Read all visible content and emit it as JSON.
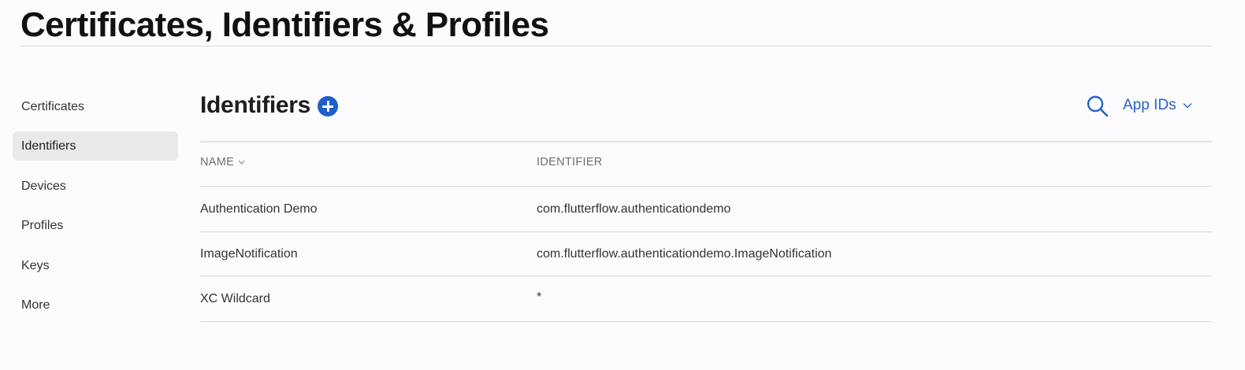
{
  "page": {
    "title": "Certificates, Identifiers & Profiles"
  },
  "sidebar": {
    "items": [
      {
        "label": "Certificates",
        "active": false
      },
      {
        "label": "Identifiers",
        "active": true
      },
      {
        "label": "Devices",
        "active": false
      },
      {
        "label": "Profiles",
        "active": false
      },
      {
        "label": "Keys",
        "active": false
      },
      {
        "label": "More",
        "active": false
      }
    ]
  },
  "section": {
    "title": "Identifiers",
    "add_icon": "plus-circle-icon",
    "search_icon": "search-icon",
    "filter_label": "App IDs",
    "filter_icon": "chevron-down-icon"
  },
  "table": {
    "columns": [
      {
        "label": "NAME",
        "sortable": true
      },
      {
        "label": "IDENTIFIER",
        "sortable": false
      }
    ],
    "rows": [
      {
        "name": "Authentication Demo",
        "identifier": "com.flutterflow.authenticationdemo"
      },
      {
        "name": "ImageNotification",
        "identifier": "com.flutterflow.authenticationdemo.ImageNotification"
      },
      {
        "name": "XC Wildcard",
        "identifier": "*"
      }
    ]
  },
  "colors": {
    "accent": "#1f5fc8",
    "link": "#2a62c4",
    "active_bg": "#e9e9ec",
    "background": "#fcfcfe"
  }
}
